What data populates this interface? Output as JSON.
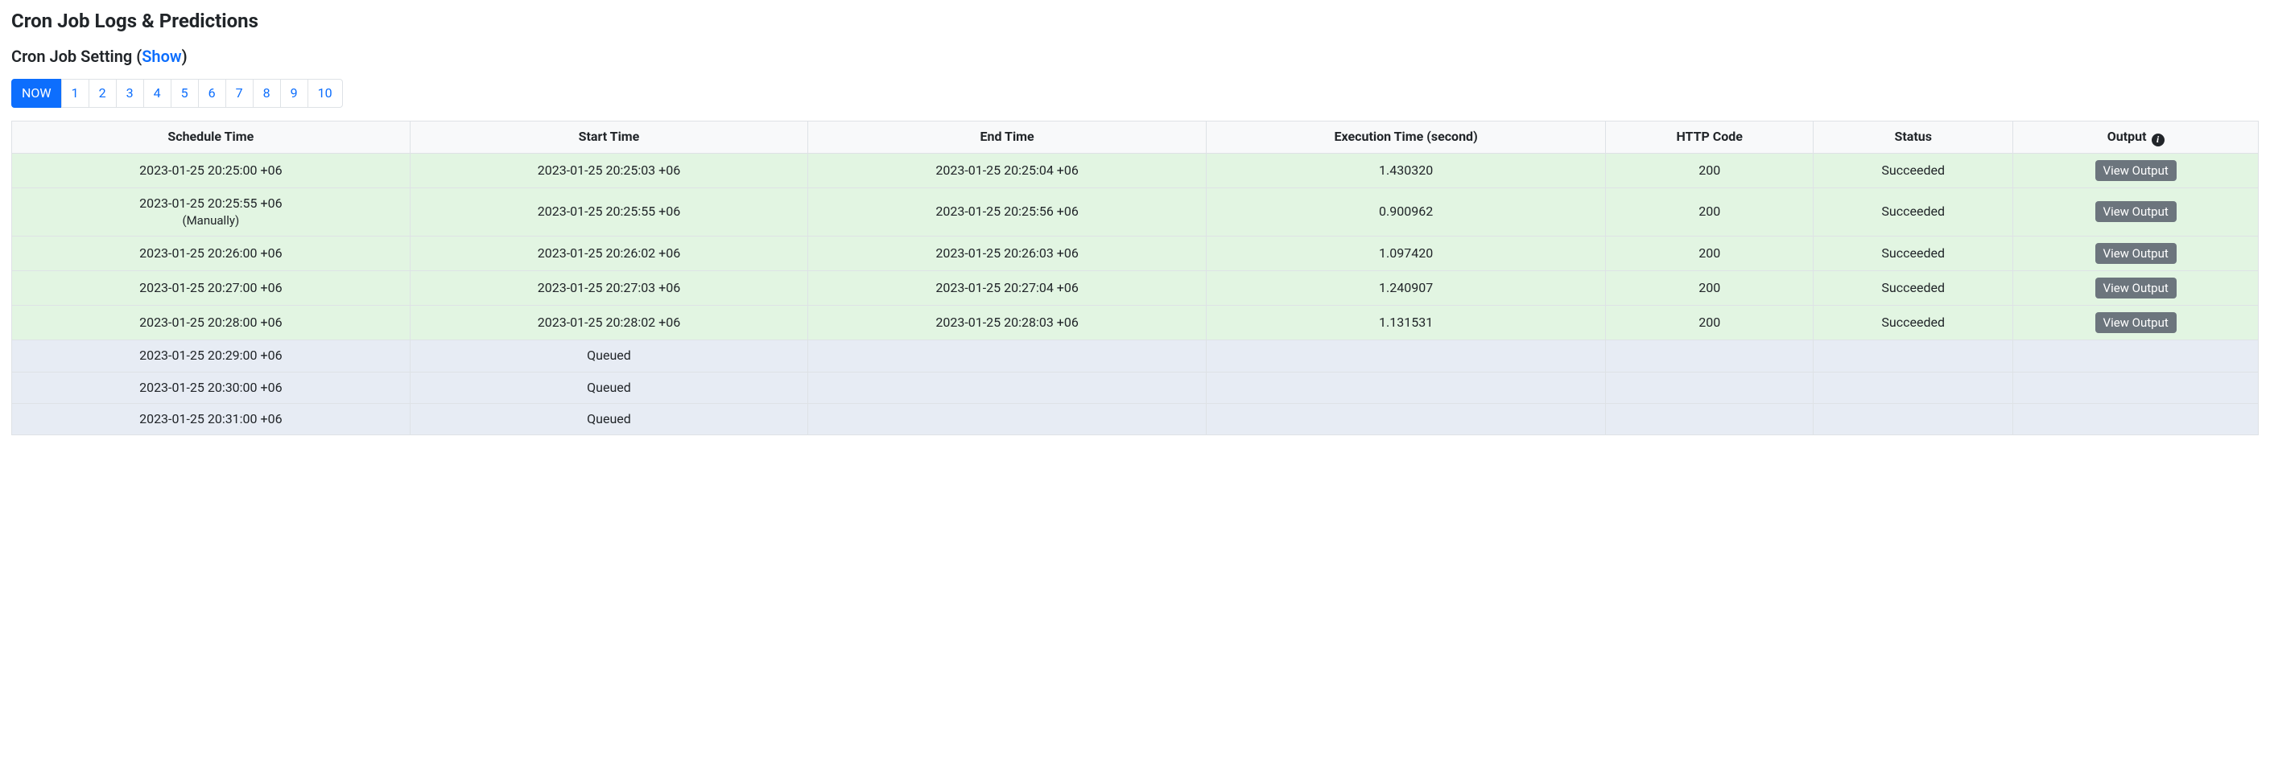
{
  "header": {
    "title": "Cron Job Logs & Predictions",
    "setting_prefix": "Cron Job Setting (",
    "setting_link": "Show",
    "setting_suffix": ")"
  },
  "pagination": {
    "items": [
      {
        "label": "NOW",
        "active": true
      },
      {
        "label": "1",
        "active": false
      },
      {
        "label": "2",
        "active": false
      },
      {
        "label": "3",
        "active": false
      },
      {
        "label": "4",
        "active": false
      },
      {
        "label": "5",
        "active": false
      },
      {
        "label": "6",
        "active": false
      },
      {
        "label": "7",
        "active": false
      },
      {
        "label": "8",
        "active": false
      },
      {
        "label": "9",
        "active": false
      },
      {
        "label": "10",
        "active": false
      }
    ]
  },
  "table": {
    "columns": {
      "schedule_time": "Schedule Time",
      "start_time": "Start Time",
      "end_time": "End Time",
      "exec_time": "Execution Time (second)",
      "http_code": "HTTP Code",
      "status": "Status",
      "output": "Output"
    },
    "output_button": "View Output",
    "rows": [
      {
        "state": "success",
        "schedule_time": "2023-01-25 20:25:00 +06",
        "schedule_note": "",
        "start_time": "2023-01-25 20:25:03 +06",
        "end_time": "2023-01-25 20:25:04 +06",
        "exec_time": "1.430320",
        "http_code": "200",
        "status": "Succeeded",
        "has_output": true
      },
      {
        "state": "success",
        "schedule_time": "2023-01-25 20:25:55 +06",
        "schedule_note": "(Manually)",
        "start_time": "2023-01-25 20:25:55 +06",
        "end_time": "2023-01-25 20:25:56 +06",
        "exec_time": "0.900962",
        "http_code": "200",
        "status": "Succeeded",
        "has_output": true
      },
      {
        "state": "success",
        "schedule_time": "2023-01-25 20:26:00 +06",
        "schedule_note": "",
        "start_time": "2023-01-25 20:26:02 +06",
        "end_time": "2023-01-25 20:26:03 +06",
        "exec_time": "1.097420",
        "http_code": "200",
        "status": "Succeeded",
        "has_output": true
      },
      {
        "state": "success",
        "schedule_time": "2023-01-25 20:27:00 +06",
        "schedule_note": "",
        "start_time": "2023-01-25 20:27:03 +06",
        "end_time": "2023-01-25 20:27:04 +06",
        "exec_time": "1.240907",
        "http_code": "200",
        "status": "Succeeded",
        "has_output": true
      },
      {
        "state": "success",
        "schedule_time": "2023-01-25 20:28:00 +06",
        "schedule_note": "",
        "start_time": "2023-01-25 20:28:02 +06",
        "end_time": "2023-01-25 20:28:03 +06",
        "exec_time": "1.131531",
        "http_code": "200",
        "status": "Succeeded",
        "has_output": true
      },
      {
        "state": "queued",
        "schedule_time": "2023-01-25 20:29:00 +06",
        "schedule_note": "",
        "start_time": "Queued",
        "end_time": "",
        "exec_time": "",
        "http_code": "",
        "status": "",
        "has_output": false
      },
      {
        "state": "queued",
        "schedule_time": "2023-01-25 20:30:00 +06",
        "schedule_note": "",
        "start_time": "Queued",
        "end_time": "",
        "exec_time": "",
        "http_code": "",
        "status": "",
        "has_output": false
      },
      {
        "state": "queued",
        "schedule_time": "2023-01-25 20:31:00 +06",
        "schedule_note": "",
        "start_time": "Queued",
        "end_time": "",
        "exec_time": "",
        "http_code": "",
        "status": "",
        "has_output": false
      }
    ]
  }
}
